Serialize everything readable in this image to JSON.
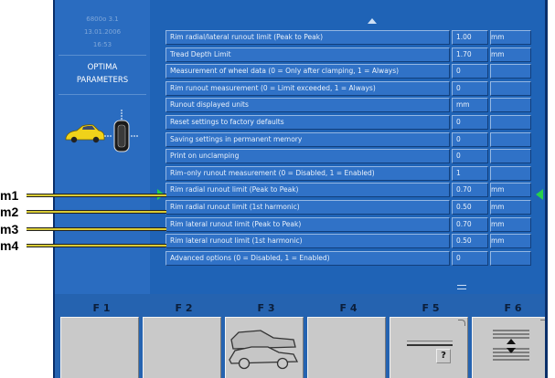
{
  "header": {
    "code": "6800o      3.1",
    "date": "13.01.2006",
    "time": "16:53",
    "title_line1": "OPTIMA",
    "title_line2": "PARAMETERS"
  },
  "rows": [
    {
      "label": "Rim radial/lateral runout limit (Peak to Peak)",
      "value": "1.00",
      "unit": "mm"
    },
    {
      "label": "Tread Depth Limit",
      "value": "1.70",
      "unit": "mm"
    },
    {
      "label": "Measurement of wheel data (0 = Only after clamping, 1 = Always)",
      "value": "0",
      "unit": ""
    },
    {
      "label": "Rim runout measurement (0 = Limit exceeded, 1 = Always)",
      "value": "0",
      "unit": ""
    },
    {
      "label": "Runout displayed units",
      "value": "mm",
      "unit": ""
    },
    {
      "label": "Reset settings to factory defaults",
      "value": "0",
      "unit": ""
    },
    {
      "label": "Saving settings in permanent memory",
      "value": "0",
      "unit": ""
    },
    {
      "label": "Print on unclamping",
      "value": "0",
      "unit": ""
    },
    {
      "label": "Rim–only runout measurement (0 = Disabled, 1 = Enabled)",
      "value": "1",
      "unit": ""
    },
    {
      "label": "Rim radial runout limit (Peak to Peak)",
      "value": "0.70",
      "unit": "mm"
    },
    {
      "label": "Rim radial runout limit (1st harmonic)",
      "value": "0.50",
      "unit": "mm"
    },
    {
      "label": "Rim lateral runout limit (Peak to Peak)",
      "value": "0.70",
      "unit": "mm"
    },
    {
      "label": "Rim lateral runout limit (1st harmonic)",
      "value": "0.50",
      "unit": "mm"
    },
    {
      "label": "Advanced options (0 = Disabled, 1 = Enabled)",
      "value": "0",
      "unit": ""
    }
  ],
  "fkeys": {
    "f1": "F 1",
    "f2": "F 2",
    "f3": "F 3",
    "f4": "F 4",
    "f5": "F 5",
    "f6": "F 6",
    "f5_symbol": "?"
  },
  "callouts": {
    "m1": "m1",
    "m2": "m2",
    "m3": "m3",
    "m4": "m4"
  },
  "colors": {
    "screen_bg": "#1f63b6",
    "cell_bg": "#3072c7",
    "selection_arrow": "#27d04a",
    "callout_line": "#d9cc36"
  },
  "icons": [
    "car-icon",
    "wheel-icon",
    "scroll-up-icon",
    "selection-arrow-icon",
    "vehicles-icon",
    "list-scroll-icon"
  ]
}
